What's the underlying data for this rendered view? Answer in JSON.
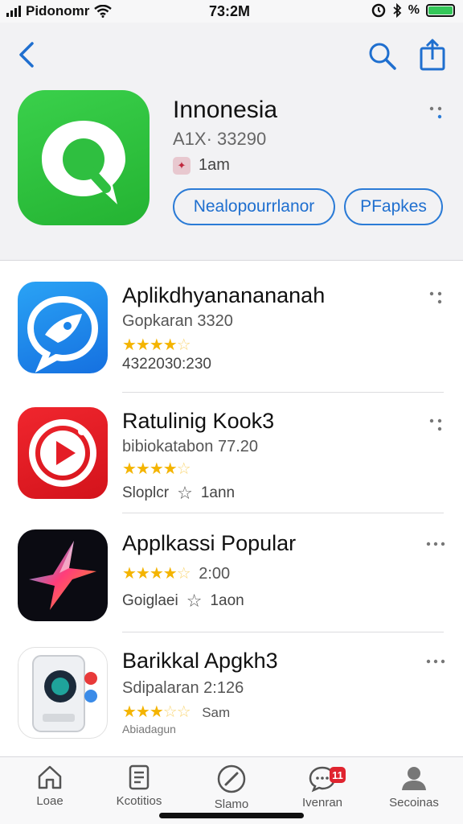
{
  "status_bar": {
    "carrier": "Pidonomr",
    "time": "73:2M",
    "battery_text": "%"
  },
  "hero": {
    "title": "Innonesia",
    "subtitle": "A1X· 33290",
    "badge_text": "1am",
    "button_primary": "Nealopourrlanor",
    "button_secondary": "PFapkes",
    "icon_color": "#2fbf40"
  },
  "apps": [
    {
      "title": "Aplikdhyananananah",
      "subtitle": "Gopkaran 3320",
      "rating_stars": "★★★★",
      "rating_empty": "☆",
      "meta_left": "4322030:230",
      "meta_right": ""
    },
    {
      "title": "Ratulinig Kook3",
      "subtitle": "bibiokatabon 77.20",
      "rating_stars": "★★★★",
      "rating_empty": "☆",
      "meta_left": "Sloplcr",
      "meta_right": "1ann"
    },
    {
      "title": "Applkassi Popular",
      "subtitle": "2:00",
      "rating_stars": "★★★★",
      "rating_empty": "☆",
      "meta_left": "Goiglaei",
      "meta_right": "1aon"
    },
    {
      "title": "Barikkal Apgkh3",
      "subtitle": "Sdipalaran 2:126",
      "rating_stars": "★★★",
      "rating_empty": "☆☆",
      "meta_left": "Abiadagun",
      "meta_right": "Sam"
    }
  ],
  "tabs": [
    {
      "label": "Loae",
      "icon": "home-icon"
    },
    {
      "label": "Kcotitios",
      "icon": "document-icon"
    },
    {
      "label": "Slamo",
      "icon": "compass-icon"
    },
    {
      "label": "Ivenran",
      "icon": "chat-icon",
      "badge": "11"
    },
    {
      "label": "Secoinas",
      "icon": "person-icon"
    }
  ],
  "colors": {
    "accent": "#2b7bd6",
    "star": "#f4b400",
    "badge": "#e0242f"
  }
}
